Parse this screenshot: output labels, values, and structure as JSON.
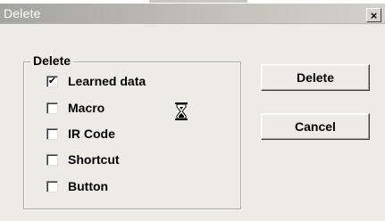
{
  "window": {
    "title": "Delete",
    "close_glyph": "×"
  },
  "group": {
    "legend": "Delete",
    "options": [
      {
        "label": "Learned data",
        "checked": true
      },
      {
        "label": "Macro",
        "checked": false
      },
      {
        "label": "IR Code",
        "checked": false
      },
      {
        "label": "Shortcut",
        "checked": false
      },
      {
        "label": "Button",
        "checked": false
      }
    ]
  },
  "buttons": {
    "delete_label": "Delete",
    "cancel_label": "Cancel"
  },
  "cursor": {
    "icon": "hourglass-icon"
  },
  "colors": {
    "dialog_bg": "#ecebe6",
    "title_bar": "#c3c2bb",
    "title_text": "#ffffff"
  }
}
